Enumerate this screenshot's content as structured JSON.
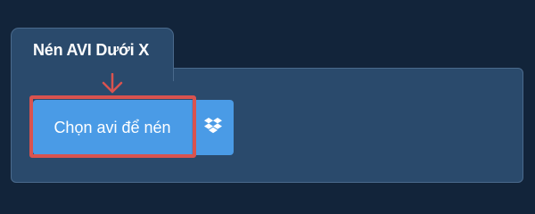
{
  "tab": {
    "title": "Nén AVI Dưới X"
  },
  "upload": {
    "choose_label": "Chọn avi để nén",
    "dropbox_icon": "dropbox-icon"
  },
  "annotation": {
    "color": "#d9534f"
  },
  "colors": {
    "background": "#12243a",
    "panel": "#2a4a6c",
    "button": "#4a9be6"
  }
}
